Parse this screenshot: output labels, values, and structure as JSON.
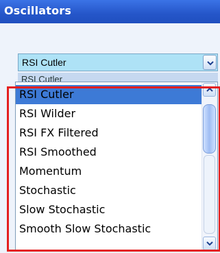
{
  "window": {
    "title": "Oscillators"
  },
  "combo": {
    "selected_value": "RSI Cutler",
    "dropdown_icon": "chevron-down-icon"
  },
  "ghost_row": {
    "text": "RSI Cutler"
  },
  "list": {
    "items": [
      {
        "label": "RSI Cutler",
        "selected": true
      },
      {
        "label": "RSI Wilder",
        "selected": false
      },
      {
        "label": "RSI FX Filtered",
        "selected": false
      },
      {
        "label": "RSI Smoothed",
        "selected": false
      },
      {
        "label": "Momentum",
        "selected": false
      },
      {
        "label": "Stochastic",
        "selected": false
      },
      {
        "label": "Slow Stochastic",
        "selected": false
      },
      {
        "label": "Smooth Slow Stochastic",
        "selected": false
      }
    ]
  },
  "scrollbar": {
    "up_icon": "chevron-up-icon",
    "down_icon": "chevron-down-icon"
  },
  "colors": {
    "title_bar": "#2556c9",
    "combo_bg": "#aee2f6",
    "selection": "#3d7ad6",
    "annotation_border": "#e41f1f"
  }
}
